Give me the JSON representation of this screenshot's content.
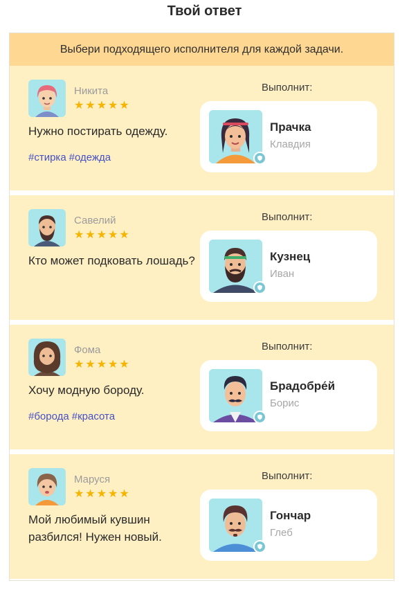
{
  "page_title": "Твой ответ",
  "instruction": "Выбери подходящего исполнителя для каждой задачи.",
  "exec_label": "Выполнит:",
  "cards": [
    {
      "customer": {
        "name": "Никита",
        "stars": "★★★★★"
      },
      "request": "Нужно постирать одежду.",
      "tags": [
        "#стирка",
        "#одежда"
      ],
      "performer": {
        "role": "Прачка",
        "name": "Клавдия"
      }
    },
    {
      "customer": {
        "name": "Савелий",
        "stars": "★★★★★"
      },
      "request": "Кто может подковать лошадь?",
      "tags": [],
      "performer": {
        "role": "Кузнец",
        "name": "Иван"
      }
    },
    {
      "customer": {
        "name": "Фома",
        "stars": "★★★★★"
      },
      "request": "Хочу модную бороду.",
      "tags": [
        "#борода",
        "#красота"
      ],
      "performer": {
        "role": "Брадобре́й",
        "name": "Борис"
      }
    },
    {
      "customer": {
        "name": "Маруся",
        "stars": "★★★★★"
      },
      "request": "Мой любимый кувшин разбился! Нужен новый.",
      "tags": [],
      "performer": {
        "role": "Гончар",
        "name": "Глеб"
      }
    }
  ],
  "colors": {
    "header_bg": "#fed793",
    "card_bg": "#fff0c4",
    "star": "#f6b400",
    "tag": "#4450c4",
    "avatar_bg": "#a8e6ec",
    "badge": "#7ac7d3"
  }
}
